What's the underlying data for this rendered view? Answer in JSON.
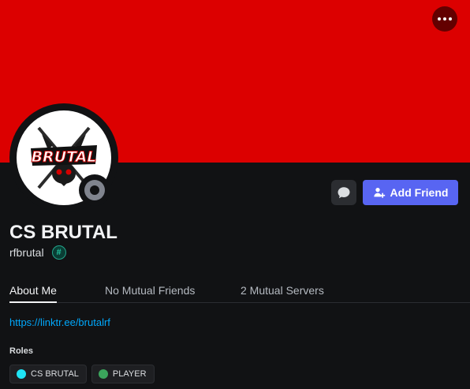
{
  "profile": {
    "display_name": "CS BRUTAL",
    "username": "rfbrutal",
    "avatar_text": "BRUTAL",
    "banner_color": "#dc0000",
    "status": "offline"
  },
  "actions": {
    "add_friend_label": "Add Friend"
  },
  "tabs": [
    {
      "label": "About Me",
      "active": true
    },
    {
      "label": "No Mutual Friends",
      "active": false
    },
    {
      "label": "2 Mutual Servers",
      "active": false
    }
  ],
  "about": {
    "link": "https://linktr.ee/brutalrf"
  },
  "roles": {
    "title": "Roles",
    "items": [
      {
        "label": "CS BRUTAL",
        "color": "#1fe4f5"
      },
      {
        "label": "PLAYER",
        "color": "#3ba55c"
      }
    ]
  },
  "colors": {
    "accent": "#5865f2",
    "link": "#00a8fc",
    "background": "#111214"
  }
}
